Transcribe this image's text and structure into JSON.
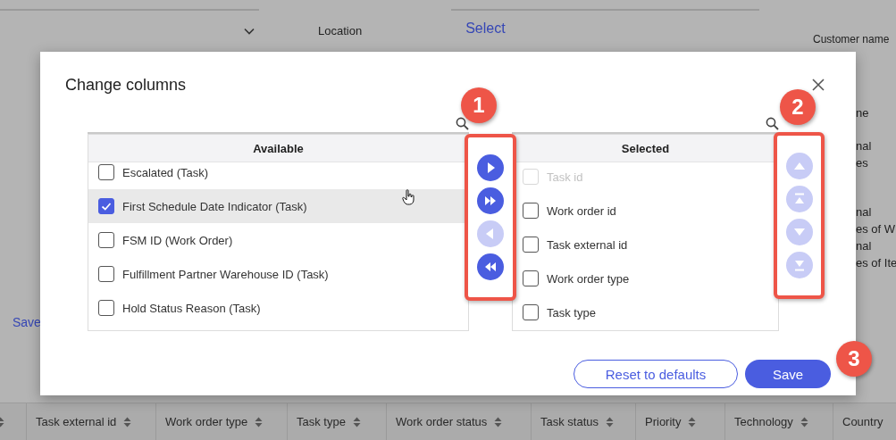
{
  "page": {
    "location_label": "Location",
    "select_link": "Select",
    "customer_labels": [
      "Customer name"
    ],
    "side_fragments": [
      [
        "ne"
      ],
      [
        "nal",
        "es"
      ],
      [
        "nal",
        "es of W"
      ],
      [
        "nal",
        "es of Ite"
      ]
    ],
    "save_link": "Save",
    "table": {
      "columns": [
        {
          "sortable": true
        },
        {
          "label": "Task external id",
          "sortable": true
        },
        {
          "label": "Work order type",
          "sortable": true
        },
        {
          "label": "Task type",
          "sortable": true
        },
        {
          "label": "Work order status",
          "sortable": true
        },
        {
          "label": "Task status",
          "sortable": true
        },
        {
          "label": "Priority",
          "sortable": true
        },
        {
          "label": "Technology",
          "sortable": true
        },
        {
          "label": "Country",
          "sortable": false
        }
      ]
    }
  },
  "dialog": {
    "title": "Change columns",
    "available": {
      "heading": "Available",
      "items": [
        {
          "label": "Escalated (Task)",
          "checked": false,
          "hovered": false
        },
        {
          "label": "First Schedule Date Indicator (Task)",
          "checked": true,
          "hovered": true
        },
        {
          "label": "FSM ID (Work Order)",
          "checked": false,
          "hovered": false
        },
        {
          "label": "Fulfillment Partner Warehouse ID (Task)",
          "checked": false,
          "hovered": false
        },
        {
          "label": "Hold Status Reason (Task)",
          "checked": false,
          "hovered": false
        }
      ]
    },
    "transfer_buttons": [
      {
        "kind": "move-right",
        "disabled": false
      },
      {
        "kind": "move-all-right",
        "disabled": false
      },
      {
        "kind": "move-left",
        "disabled": true
      },
      {
        "kind": "move-all-left",
        "disabled": false
      }
    ],
    "selected": {
      "heading": "Selected",
      "items": [
        {
          "label": "Task id",
          "checked": false,
          "disabled": true
        },
        {
          "label": "Work order id",
          "checked": false,
          "disabled": false
        },
        {
          "label": "Task external id",
          "checked": false,
          "disabled": false
        },
        {
          "label": "Work order type",
          "checked": false,
          "disabled": false
        },
        {
          "label": "Task type",
          "checked": false,
          "disabled": false
        }
      ]
    },
    "order_buttons": [
      {
        "kind": "up",
        "disabled": true
      },
      {
        "kind": "top",
        "disabled": true
      },
      {
        "kind": "down",
        "disabled": true
      },
      {
        "kind": "bottom",
        "disabled": true
      }
    ],
    "footer_buttons": [
      {
        "label": "Reset to defaults",
        "kind": "secondary"
      },
      {
        "label": "Save",
        "kind": "primary"
      }
    ],
    "annotations": [
      {
        "number": "1",
        "kind": "transfer"
      },
      {
        "number": "2",
        "kind": "order"
      },
      {
        "number": "3",
        "kind": "save"
      }
    ]
  }
}
